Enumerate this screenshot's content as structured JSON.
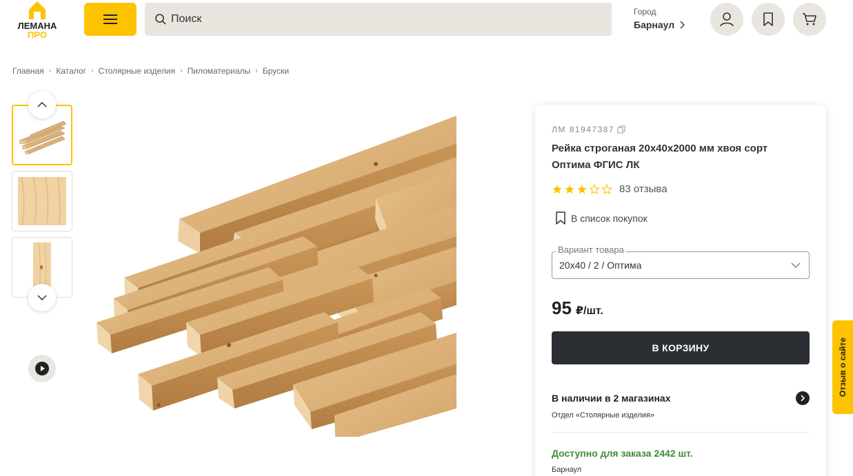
{
  "header": {
    "logo_text_top": "ЛЕМАНА",
    "logo_text_bottom": "ПРО",
    "search_placeholder": "Поиск",
    "city_label": "Город",
    "city_value": "Барнаул"
  },
  "breadcrumbs": [
    "Главная",
    "Каталог",
    "Столярные изделия",
    "Пиломатериалы",
    "Бруски"
  ],
  "product": {
    "sku": "ЛМ 81947387",
    "title": "Рейка строганая 20x40x2000 мм хвоя сорт Оптима ФГИС ЛК",
    "rating": 3,
    "rating_max": 5,
    "reviews": "83 отзыва",
    "wishlist_label": "В список покупок",
    "variant_legend": "Вариант товара",
    "variant_value": "20x40 / 2 / Оптима",
    "price_value": "95",
    "price_unit": "₽/шт.",
    "cart_button": "В КОРЗИНУ",
    "stock_label": "В наличии в 2 магазинах",
    "department": "Отдел «Столярные изделия»",
    "order_available": "Доступно для заказа 2442 шт.",
    "order_city": "Барнаул"
  },
  "feedback_tab": "Отзыв о сайте",
  "colors": {
    "brand_yellow": "#fdc300",
    "header_gray": "#e8e6df",
    "button_dark": "#2b2f33",
    "in_stock_green": "#3e8a34"
  }
}
